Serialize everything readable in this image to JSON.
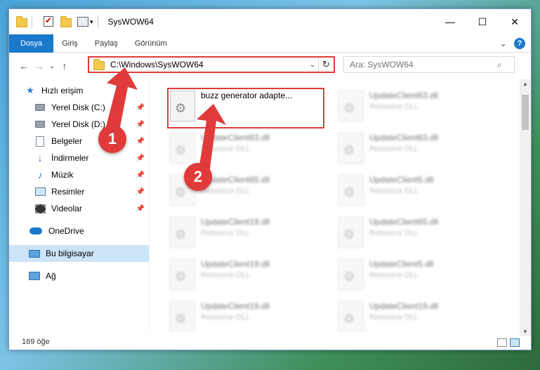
{
  "window": {
    "title": "SysWOW64",
    "controls": {
      "minimize": "—",
      "maximize": "☐",
      "close": "✕"
    }
  },
  "ribbon": {
    "tabs": [
      "Dosya",
      "Giriş",
      "Paylaş",
      "Görünüm"
    ],
    "expand": "⌄",
    "help": "?"
  },
  "nav": {
    "back": "←",
    "forward": "→",
    "recent": "⌄",
    "up": "↑",
    "address": "C:\\Windows\\SysWOW64",
    "address_drop": "⌄",
    "refresh": "↻",
    "search_placeholder": "Ara: SysWOW64",
    "search_icon": "⌕"
  },
  "sidebar": {
    "quick_access": "Hızlı erişim",
    "items": [
      {
        "label": "Yerel Disk (C:)",
        "icon": "drive-icon",
        "pinned": true
      },
      {
        "label": "Yerel Disk (D:)",
        "icon": "drive-icon",
        "pinned": true
      },
      {
        "label": "Belgeler",
        "icon": "doc-icon",
        "pinned": true
      },
      {
        "label": "İndirmeler",
        "icon": "down-icon",
        "pinned": true
      },
      {
        "label": "Müzik",
        "icon": "music-icon",
        "pinned": true
      },
      {
        "label": "Resimler",
        "icon": "pic-icon",
        "pinned": true
      },
      {
        "label": "Videolar",
        "icon": "video-icon",
        "pinned": true
      }
    ],
    "pin_glyph": "📌",
    "onedrive": "OneDrive",
    "this_pc": "Bu bilgisayar",
    "network": "Ağ"
  },
  "files": {
    "highlighted": {
      "name": "buzz generator adapte...",
      "type": ""
    },
    "right_column": [
      {
        "name": "UpdateClient63.dll",
        "type": "Resource DLL"
      },
      {
        "name": "UpdateClient63.dll",
        "type": "Resource DLL"
      },
      {
        "name": "UpdateClient5.dll",
        "type": "Resource DLL"
      },
      {
        "name": "UpdateClient65.dll",
        "type": "Resource DLL"
      },
      {
        "name": "UpdateClient5.dll",
        "type": "Resource DLL"
      },
      {
        "name": "UpdateClient19.dll",
        "type": "Resource DLL"
      }
    ],
    "left_column": [
      {
        "name": "UpdateClient63.dll",
        "type": "Resource DLL"
      },
      {
        "name": "UpdateClient65.dll",
        "type": "Resource DLL"
      },
      {
        "name": "UpdateClient19.dll",
        "type": "Resource DLL"
      },
      {
        "name": "UpdateClient19.dll",
        "type": "Resource DLL"
      },
      {
        "name": "UpdateClient19.dll",
        "type": "Resource DLL"
      }
    ]
  },
  "status": {
    "item_count": "169 öğe"
  },
  "callouts": {
    "one": "1",
    "two": "2"
  }
}
